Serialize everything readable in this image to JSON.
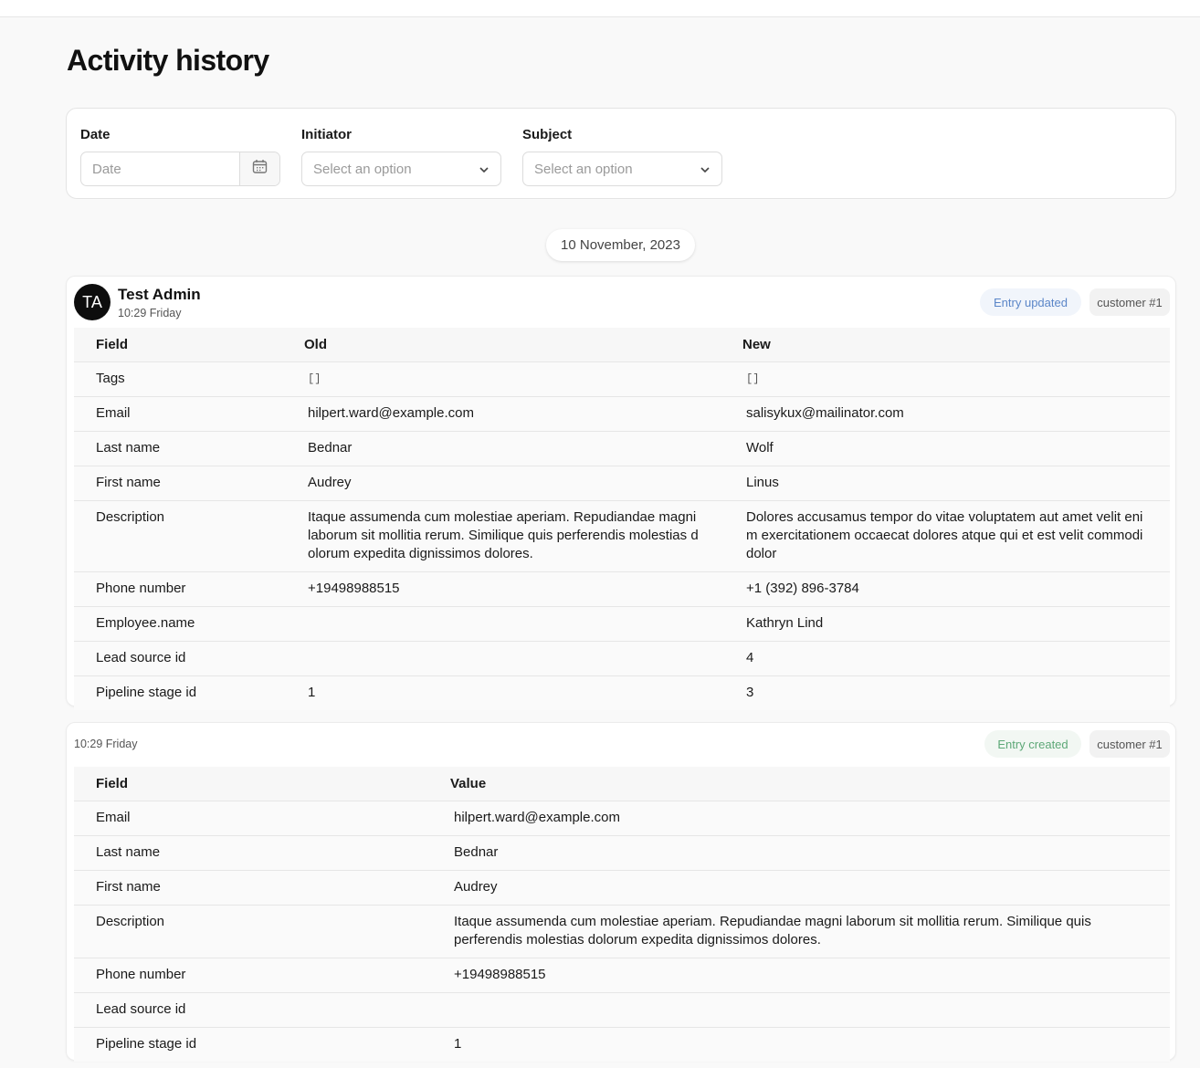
{
  "page": {
    "title": "Activity history"
  },
  "filters": {
    "date": {
      "label": "Date",
      "placeholder": "Date"
    },
    "initiator": {
      "label": "Initiator",
      "placeholder": "Select an option"
    },
    "subject": {
      "label": "Subject",
      "placeholder": "Select an option"
    }
  },
  "day_separator": "10 November, 2023",
  "entries": [
    {
      "user_initials": "TA",
      "user_name": "Test Admin",
      "time": "10:29 Friday",
      "action_badge": "Entry updated",
      "subject_badge": "customer #1",
      "columns": [
        "Field",
        "Old",
        "New"
      ],
      "rows": [
        {
          "field": "Tags",
          "old": "[]",
          "new": "[]"
        },
        {
          "field": "Email",
          "old": "hilpert.ward@example.com",
          "new": "salisykux@mailinator.com"
        },
        {
          "field": "Last name",
          "old": "Bednar",
          "new": "Wolf"
        },
        {
          "field": "First name",
          "old": "Audrey",
          "new": "Linus"
        },
        {
          "field": "Description",
          "old": "Itaque assumenda cum molestiae aperiam. Repudiandae magni laborum sit mollitia rerum. Similique quis perferendis molestias dolorum expedita dignissimos dolores.",
          "new": "Dolores accusamus tempor do vitae voluptatem aut amet velit enim exercitationem occaecat dolores atque qui et est velit commodi dolor"
        },
        {
          "field": "Phone number",
          "old": "+19498988515",
          "new": "+1 (392) 896-3784"
        },
        {
          "field": "Employee.name",
          "old": "",
          "new": "Kathryn Lind"
        },
        {
          "field": "Lead source id",
          "old": "",
          "new": "4"
        },
        {
          "field": "Pipeline stage id",
          "old": "1",
          "new": "3"
        }
      ]
    },
    {
      "time": "10:29 Friday",
      "action_badge": "Entry created",
      "subject_badge": "customer #1",
      "columns": [
        "Field",
        "Value"
      ],
      "rows": [
        {
          "field": "Email",
          "value": "hilpert.ward@example.com"
        },
        {
          "field": "Last name",
          "value": "Bednar"
        },
        {
          "field": "First name",
          "value": "Audrey"
        },
        {
          "field": "Description",
          "value": "Itaque assumenda cum molestiae aperiam. Repudiandae magni laborum sit mollitia rerum. Similique quis perferendis molestias dolorum expedita dignissimos dolores."
        },
        {
          "field": "Phone number",
          "value": "+19498988515"
        },
        {
          "field": "Lead source id",
          "value": ""
        },
        {
          "field": "Pipeline stage id",
          "value": "1"
        }
      ]
    }
  ],
  "icons": {
    "calendar": "calendar-icon",
    "chevron": "chevron-down-icon"
  },
  "colors": {
    "updated_badge_text": "#5b86c8",
    "created_badge_text": "#5da877",
    "avatar_bg": "#0d0d0d"
  }
}
